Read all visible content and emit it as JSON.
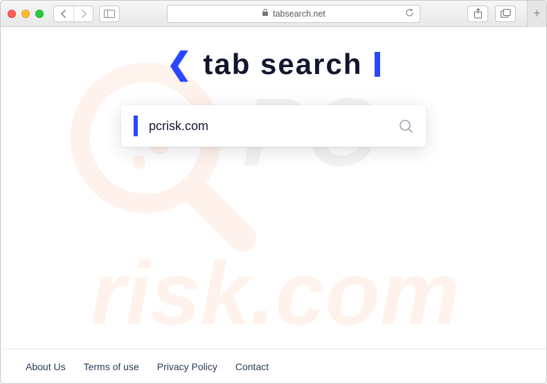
{
  "browser": {
    "url": "tabsearch.net"
  },
  "logo": {
    "text": "tab search"
  },
  "search": {
    "value": "pcrisk.com",
    "placeholder": ""
  },
  "footer": {
    "links": [
      "About Us",
      "Terms of use",
      "Privacy Policy",
      "Contact"
    ]
  },
  "colors": {
    "accent": "#2947ff",
    "text_dark": "#12172d"
  }
}
